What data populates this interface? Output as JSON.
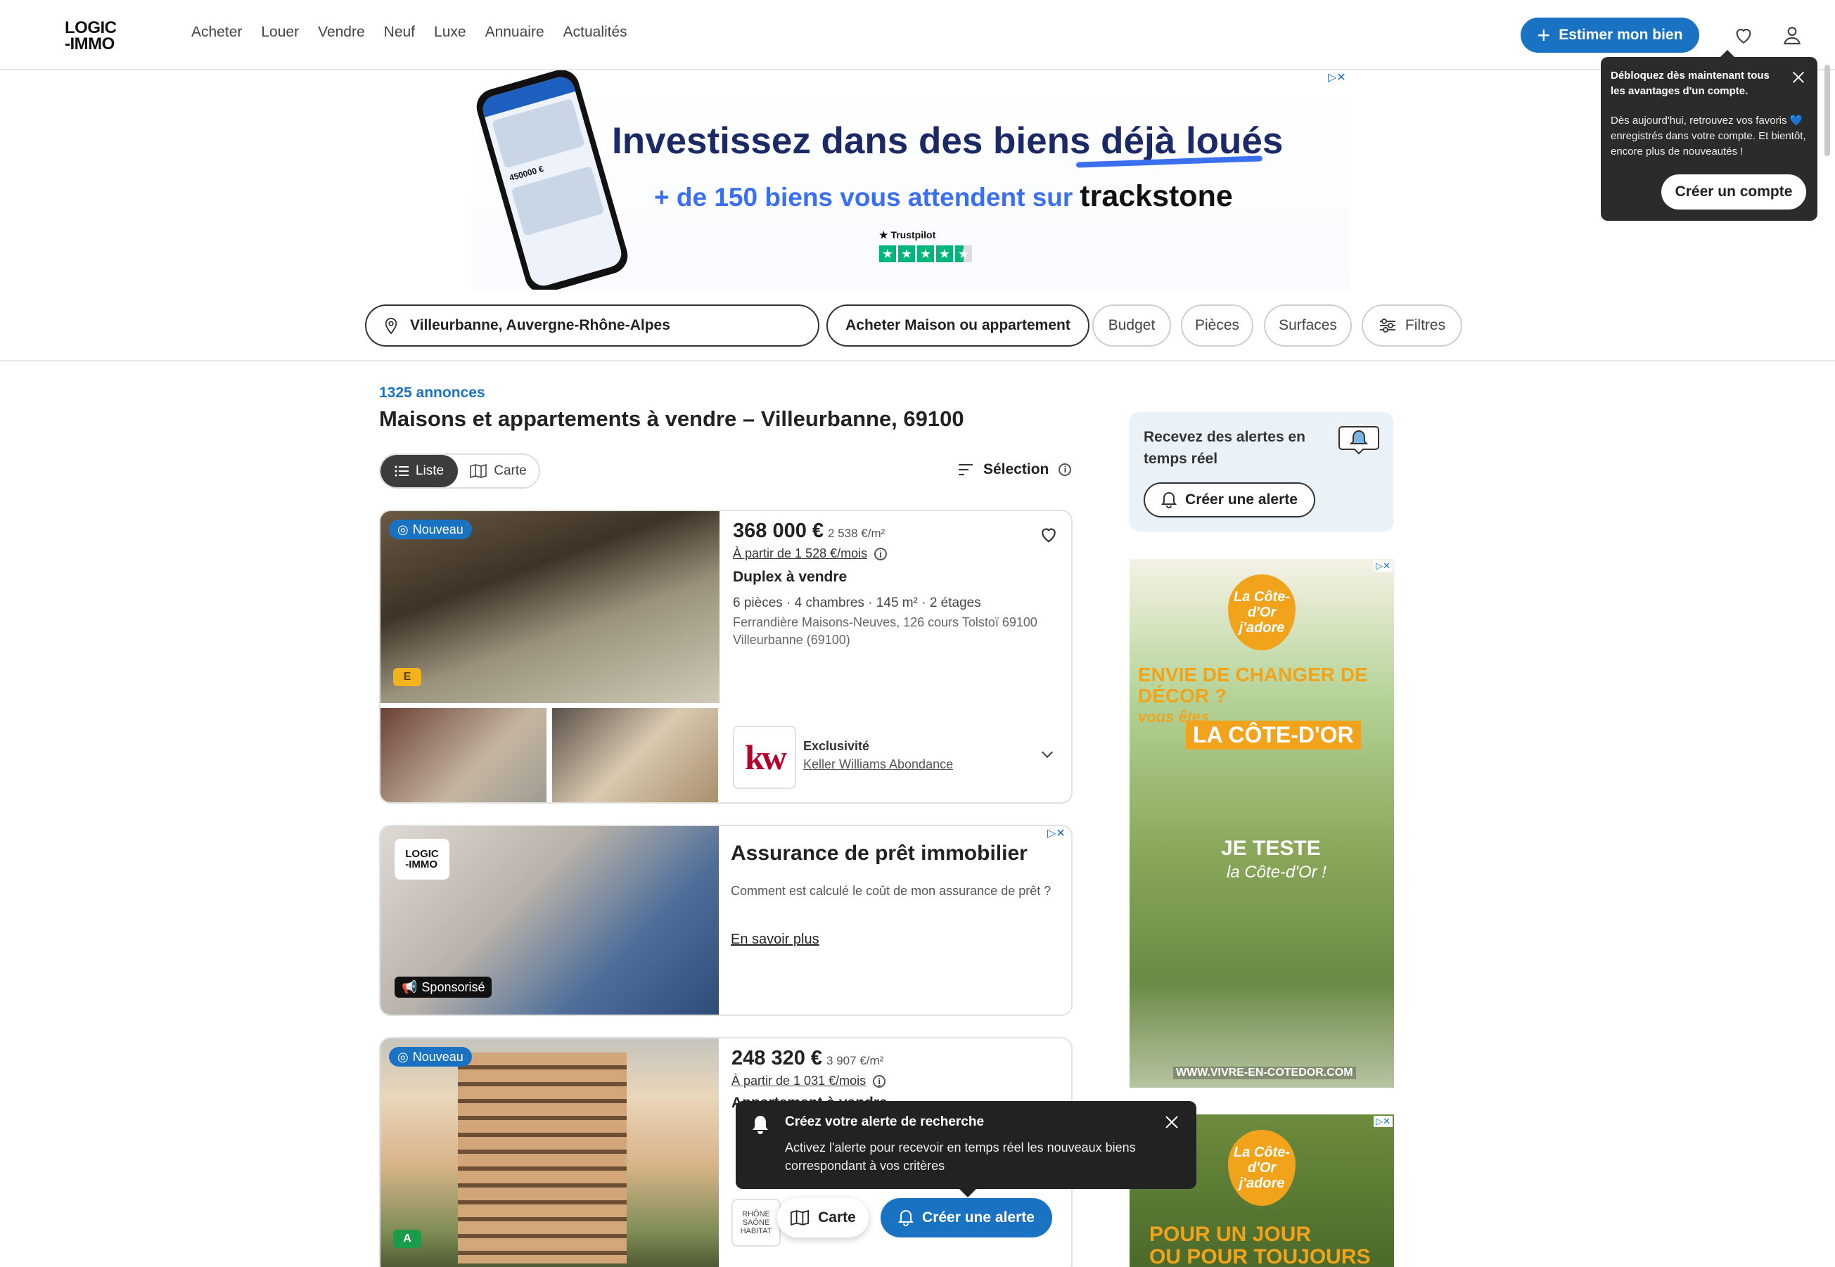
{
  "header": {
    "logo_line1": "LOGIC",
    "logo_line2": "-IMMO",
    "nav": [
      "Acheter",
      "Louer",
      "Vendre",
      "Neuf",
      "Luxe",
      "Annuaire",
      "Actualités"
    ],
    "estimate_button": "Estimer mon bien",
    "accent_color": "#1a73c2"
  },
  "top_ad": {
    "line1": "Investissez dans des biens déjà loués",
    "line2": "+ de 150 biens vous attendent sur",
    "brand": "trackstone",
    "trustpilot": "Trustpilot",
    "phone_price": "450000 €"
  },
  "search": {
    "location": "Villeurbanne, Auvergne-Rhône-Alpes",
    "type": "Acheter Maison ou appartement",
    "budget": "Budget",
    "pieces": "Pièces",
    "surfaces": "Surfaces",
    "filtres": "Filtres"
  },
  "results": {
    "count": "1325 annonces",
    "title": "Maisons et appartements à vendre – Villeurbanne, 69100",
    "view_list": "Liste",
    "view_map": "Carte",
    "sort": "Sélection"
  },
  "listing1": {
    "badge": "Nouveau",
    "dpe": "E",
    "price": "368 000 €",
    "price_per_m2": "2 538 €/m²",
    "monthly": "À partir de 1 528 €/mois",
    "type": "Duplex à vendre",
    "features": "6 pièces  ·  4 chambres  ·  145 m²  ·  2 étages",
    "address": "Ferrandière Maisons-Neuves, 126 cours Tolstoï 69100 Villeurbanne (69100)",
    "agency_label": "Exclusivité",
    "agency_name": "Keller Williams Abondance",
    "agency_logo": "kw"
  },
  "ad_card": {
    "title": "Assurance de prêt immobilier",
    "desc": "Comment est calculé le coût de mon assurance de prêt ?",
    "link": "En savoir plus",
    "sponsored": "Sponsorisé",
    "logo_line1": "LOGIC",
    "logo_line2": "-IMMO"
  },
  "listing2": {
    "badge": "Nouveau",
    "dpe": "A",
    "price": "248 320 €",
    "price_per_m2": "3 907 €/m²",
    "monthly": "À partir de 1 031 €/mois",
    "type": "Appartement à vendre",
    "agency_logo_text": "RHÔNE SAÔNE HABITAT"
  },
  "alert_box": {
    "text": "Recevez des alertes en temps réel",
    "button": "Créer une alerte"
  },
  "side_ad1": {
    "badge": "La Côte-d'Or j'adore",
    "line1": "ENVIE DE CHANGER DE DÉCOR ?",
    "line1b": "vous êtes",
    "line2": "LA CÔTE-D'OR",
    "line3": "JE TESTE",
    "line4": "la Côte-d'Or !",
    "url": "WWW.VIVRE-EN-COTEDOR.COM"
  },
  "side_ad2": {
    "badge": "La Côte-d'Or j'adore",
    "line1": "POUR UN JOUR",
    "line2": "OU POUR TOUJOURS"
  },
  "account_popover": {
    "title": "Débloquez dès maintenant tous les avantages d'un compte.",
    "body": "Dès aujourd'hui, retrouvez vos favoris 💙 enregistrés dans votre compte. Et bientôt, encore plus de nouveautés !",
    "button": "Créer un compte"
  },
  "alert_popover": {
    "title": "Créez votre alerte de recherche",
    "body": "Activez l'alerte pour recevoir en temps réel les nouveaux biens correspondant à vos critères"
  },
  "floating": {
    "map": "Carte",
    "alert": "Créer une alerte"
  },
  "icons": [
    "heart-icon",
    "user-icon",
    "location-pin-icon",
    "filter-icon",
    "list-icon",
    "map-icon",
    "sort-icon",
    "info-icon",
    "bell-icon",
    "close-icon",
    "chevron-down-icon",
    "plus-icon",
    "megaphone-icon"
  ]
}
